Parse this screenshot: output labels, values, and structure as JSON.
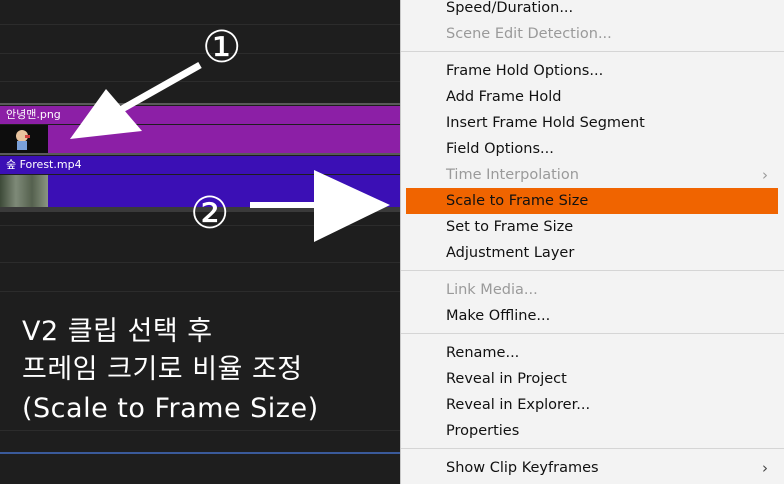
{
  "clips": {
    "v2": {
      "name": "안녕맨.png",
      "color": "#8c1fa6"
    },
    "v1": {
      "name": "숲 Forest.mp4",
      "color": "#3b0fb5"
    }
  },
  "annotations": {
    "marker_1": "①",
    "marker_2": "②",
    "line1": "V2 클립 선택 후",
    "line2": "프레임 크기로 비율 조정",
    "line3": "(Scale to Frame Size)"
  },
  "menu": {
    "items": [
      {
        "label": "Speed/Duration...",
        "disabled": false
      },
      {
        "label": "Scene Edit Detection...",
        "disabled": true
      },
      {
        "label": "Frame Hold Options...",
        "disabled": false
      },
      {
        "label": "Add Frame Hold",
        "disabled": false
      },
      {
        "label": "Insert Frame Hold Segment",
        "disabled": false
      },
      {
        "label": "Field Options...",
        "disabled": false
      },
      {
        "label": "Time Interpolation",
        "disabled": true,
        "submenu": true
      },
      {
        "label": "Scale to Frame Size",
        "disabled": false,
        "selected": true
      },
      {
        "label": "Set to Frame Size",
        "disabled": false
      },
      {
        "label": "Adjustment Layer",
        "disabled": false
      },
      {
        "label": "Link Media...",
        "disabled": true
      },
      {
        "label": "Make Offline...",
        "disabled": false
      },
      {
        "label": "Rename...",
        "disabled": false
      },
      {
        "label": "Reveal in Project",
        "disabled": false
      },
      {
        "label": "Reveal in Explorer...",
        "disabled": false
      },
      {
        "label": "Properties",
        "disabled": false
      },
      {
        "label": "Show Clip Keyframes",
        "disabled": false,
        "submenu": true
      }
    ],
    "chevron_icon": "chevron-right-icon",
    "highlight_color": "#f06400"
  }
}
